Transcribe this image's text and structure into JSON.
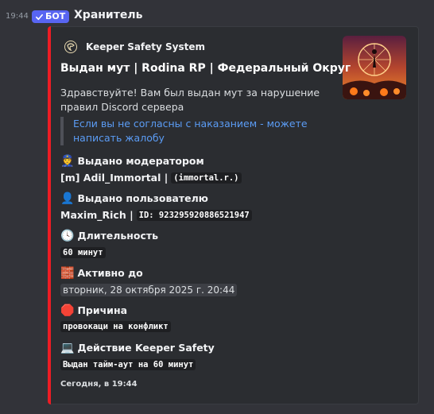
{
  "message": {
    "timestamp": "19:44",
    "bot_badge": "БОТ",
    "username": "Хранитель"
  },
  "embed": {
    "accent_color": "#ed1c24",
    "author": "Keeper Safety System",
    "title": "Выдан мут | Rodina RP | Федеральный Округ",
    "description": "Здравствуйте! Вам был выдан мут за нарушение правил Discord сервера",
    "quote": "Если вы не согласны с наказанием - можете написать жалобу",
    "fields": {
      "moderator": {
        "emoji": "👮",
        "name": "Выдано модератором",
        "value_text": "[m] Adil_Immortal |",
        "value_code": "(immortal.r.)"
      },
      "user": {
        "emoji": "👤",
        "name": "Выдано пользователю",
        "value_text": "Maxim_Rich |",
        "value_code": "ID: 923295920886521947"
      },
      "duration": {
        "emoji": "🕓",
        "name": "Длительность",
        "value_code": "60 минут"
      },
      "active_until": {
        "emoji": "🧱",
        "name": "Активно до",
        "value": "вторник, 28 октября 2025 г. 20:44"
      },
      "reason": {
        "emoji": "🛑",
        "name": "Причина",
        "value_code": "провокаци на конфликт"
      },
      "action": {
        "emoji": "💻",
        "name": "Действие Keeper Safety",
        "value_code": "Выдан тайм-аут на 60 минут"
      }
    },
    "footer": "Сегодня, в 19:44"
  }
}
